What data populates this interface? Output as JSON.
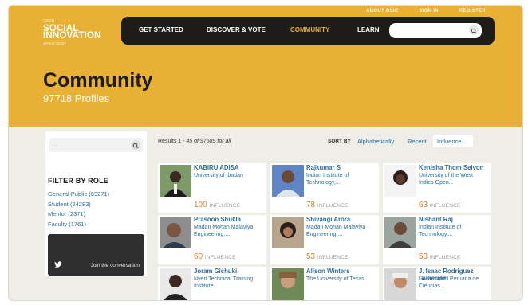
{
  "top_links": [
    "ABOUT DSIC",
    "SIGN IN",
    "REGISTER"
  ],
  "logo": {
    "line0": "OPEN",
    "line1": "SOCIAL",
    "line2": "INNOVATION",
    "line3": "SPACE BOOT"
  },
  "nav": {
    "items": [
      {
        "label": "GET STARTED",
        "active": false
      },
      {
        "label": "DISCOVER & VOTE",
        "active": false
      },
      {
        "label": "COMMUNITY",
        "active": true
      },
      {
        "label": "LEARN",
        "active": false
      }
    ],
    "search_placeholder": ""
  },
  "page": {
    "title": "Community",
    "count": "97718",
    "count_label": "Profiles"
  },
  "sidebar": {
    "search_placeholder": "..",
    "filter_title": "FILTER BY ROLE",
    "filters": [
      "General Public (69271)",
      "Student (24283)",
      "Mentor (2371)",
      "Faculty (1761)"
    ],
    "twitter_text": "Join the conversation"
  },
  "results": {
    "prefix": "Results",
    "range": "1 - 45",
    "of": "of",
    "total": "97689",
    "suffix": "for all"
  },
  "sort": {
    "label": "SORT BY",
    "options": [
      "Alphabetically",
      "Recent"
    ],
    "active": "Influence"
  },
  "influence_label": "INFLUENCE",
  "colors": {
    "accent": "#e8b035",
    "link": "#2b6e9e",
    "influence": "#e2802f",
    "nav_bg": "#1e1c19"
  },
  "profiles": [
    {
      "name": "KABIRU ADISA",
      "org": "University of Ibadan",
      "influence": "100"
    },
    {
      "name": "Rajkumar S",
      "org": "Indian Institute of Technology,...",
      "influence": "78"
    },
    {
      "name": "Kenisha Thom Selvon",
      "org": "University of the West Indies Open...",
      "influence": "63"
    },
    {
      "name": "Prasoon Shukla",
      "org": "Madan Mohan Malaviya Engineering,...",
      "influence": "60"
    },
    {
      "name": "Shivangi Arora",
      "org": "Madan Mohan Malaviya Engineering,...",
      "influence": "53"
    },
    {
      "name": "Nishant Raj",
      "org": "Indian Institute of Technology,...",
      "influence": "53"
    },
    {
      "name": "Joram Gichuki",
      "org": "Nyeri Technical Training Institute",
      "influence": ""
    },
    {
      "name": "Alison Winters",
      "org": "The University of Texas...",
      "influence": ""
    },
    {
      "name": "J. Isaac Rodriguez Gutierrez",
      "org": "Universidad Peruana de Ciencias...",
      "influence": ""
    }
  ]
}
